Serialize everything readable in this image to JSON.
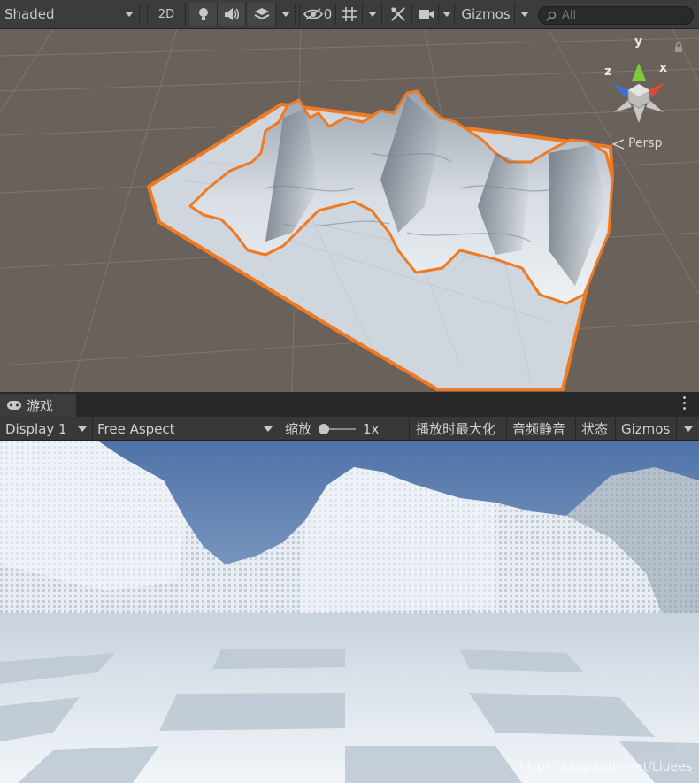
{
  "scene_toolbar": {
    "shading_mode": "Shaded",
    "mode_2d_label": "2D",
    "hidden_count": "0",
    "gizmos_label": "Gizmos",
    "search_placeholder": "All"
  },
  "scene_view": {
    "projection_label": "Persp",
    "axis_x": "x",
    "axis_y": "y",
    "axis_z": "z"
  },
  "game_tab": {
    "label": "游戏"
  },
  "game_toolbar": {
    "display": "Display 1",
    "aspect": "Free Aspect",
    "scale_label": "缩放",
    "scale_value": "1x",
    "maximize_on_play": "播放时最大化",
    "mute_audio": "音频静音",
    "stats": "状态",
    "gizmos_label": "Gizmos"
  },
  "game_view": {
    "watermark": "https://blog.csdn.net/Liuees"
  },
  "colors": {
    "editor_bg": "#3c3c3c",
    "selection_outline": "#f07a22",
    "sky": "#5e82b7",
    "axis_x": "#d84a3a",
    "axis_y": "#7ccb3a",
    "axis_z": "#3c6fd8"
  }
}
